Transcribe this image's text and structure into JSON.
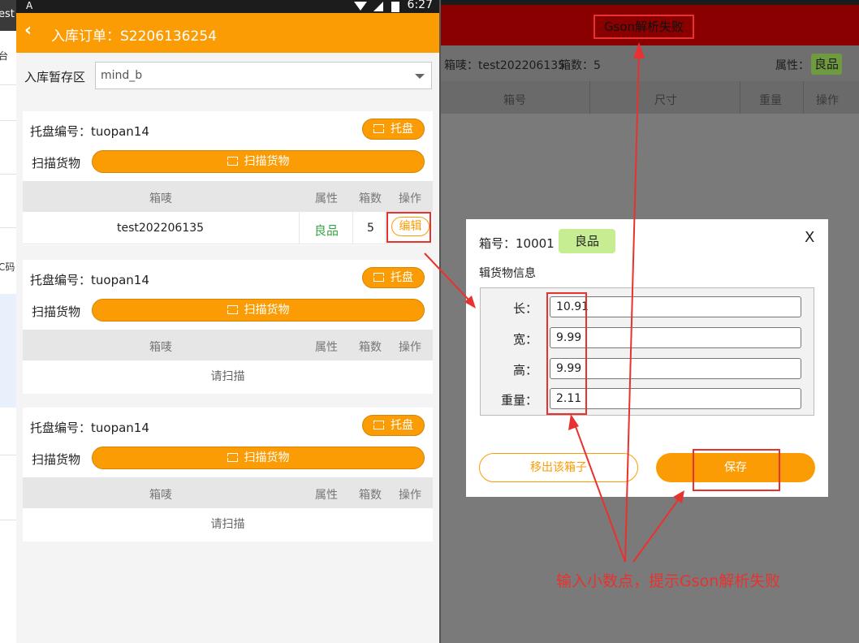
{
  "pc_fragments": [
    "est",
    "台",
    "C码"
  ],
  "left_phone": {
    "status": {
      "time": "6:27",
      "left_glyph": "A"
    },
    "appbar": {
      "title": "入库订单：S2206136254"
    },
    "staging": {
      "label": "入库暂存区",
      "value": "mind_b"
    },
    "cards": [
      {
        "pallet_label": "托盘编号：tuopan14",
        "pallet_button": "托盘",
        "scan_label": "扫描货物",
        "scan_button": "扫描货物",
        "headers": [
          "箱唛",
          "属性",
          "箱数",
          "操作"
        ],
        "row": {
          "mark": "test202206135",
          "attr": "良品",
          "count": "5",
          "action": "编辑"
        }
      },
      {
        "pallet_label": "托盘编号：tuopan14",
        "pallet_button": "托盘",
        "scan_label": "扫描货物",
        "scan_button": "扫描货物",
        "headers": [
          "箱唛",
          "属性",
          "箱数",
          "操作"
        ],
        "empty": "请扫描"
      },
      {
        "pallet_label": "托盘编号：tuopan14",
        "pallet_button": "托盘",
        "scan_label": "扫描货物",
        "scan_button": "扫描货物",
        "headers": [
          "箱唛",
          "属性",
          "箱数",
          "操作"
        ],
        "empty": "请扫描"
      }
    ]
  },
  "right_tablet": {
    "toast": "Gson解析失败",
    "info": {
      "mark": "箱唛：test202206135",
      "count": "箱数：5",
      "attr_label": "属性：",
      "attr_value": "良品"
    },
    "headers": [
      "箱号",
      "尺寸",
      "重量",
      "操作"
    ],
    "dialog": {
      "box_no": "箱号：10001",
      "attr": "良品",
      "close": "X",
      "subtitle": "辑货物信息",
      "fields": [
        {
          "label": "长：",
          "value": "10.91"
        },
        {
          "label": "宽：",
          "value": "9.99"
        },
        {
          "label": "高：",
          "value": "9.99"
        },
        {
          "label": "重量：",
          "value": "2.11"
        }
      ],
      "remove_button": "移出该箱子",
      "save_button": "保存"
    },
    "annotation": "输入小数点，提示Gson解析失败"
  },
  "colors": {
    "accent": "#fb9c04",
    "annotation": "#e8322f",
    "good": "#4caf50",
    "toast_bar": "#8a0000"
  }
}
